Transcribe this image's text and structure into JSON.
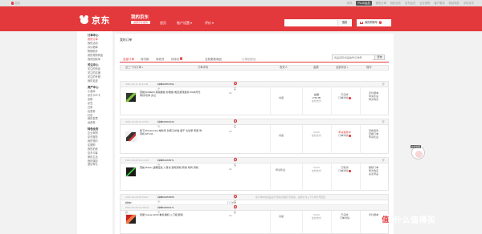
{
  "topbar": {
    "location": "北京",
    "links": [
      "你好，",
      "PLUS会员",
      "我的订单",
      "我的京东",
      "京东会员",
      "企业采购",
      "客户服务",
      "网站导航",
      "手机京东"
    ]
  },
  "header": {
    "logo": "京东",
    "myjd": "我的京东",
    "back": "返回京东首页",
    "nav": [
      "首页",
      "账户设置",
      "评价"
    ],
    "search_placeholder": "",
    "search_button": "搜索",
    "cart_label": "我的购物车",
    "cart_count": "0"
  },
  "sidebar": [
    {
      "title": "订单中心",
      "items": [
        "我的订单",
        "我的活动",
        "评价晒单",
        "购物助手",
        "我的常购商品",
        "我的回收单"
      ]
    },
    {
      "title": "关注中心",
      "items": [
        "关注的商品",
        "关注的店铺",
        "关注的专辑",
        "我的足迹"
      ]
    },
    {
      "title": "资产中心",
      "items": [
        "小金库",
        "京东卡/E卡",
        "余额",
        "京豆",
        "白条",
        "优惠券",
        "红包",
        "我的发票",
        "运费券"
      ]
    },
    {
      "title": "特色业务",
      "items": [
        "企业采购",
        "京东服务",
        "我的预约",
        "定期购",
        "我的拍卖",
        "京东众筹",
        "便民生活",
        "我的保险",
        "邀请有礼"
      ]
    }
  ],
  "main": {
    "title": "我的订单",
    "tabs": [
      {
        "label": "全部订单",
        "count": ""
      },
      {
        "label": "待付款",
        "count": ""
      },
      {
        "label": "待收货",
        "count": ""
      },
      {
        "label": "待评价",
        "count": "1"
      },
      {
        "label": "当前更新商品",
        "count": ""
      },
      {
        "label": "订单回收站",
        "count": ""
      }
    ],
    "order_search_placeholder": "商品名称/商品编号/订单号",
    "order_search_button": "查询",
    "advanced": "高级",
    "columns": [
      "近三个月订单",
      "订单详情",
      "收货人",
      "金额",
      "全部状态",
      "操作"
    ]
  },
  "orders": [
    {
      "date": "2021-01-11 11:31:46",
      "order_no_label": "订单号：",
      "order_no": "224693657694",
      "shop": "京东",
      "product": "雷蛇(RAZER) 炼狱蝰蛇 标准版 电竞游戏鼠标 RGB背光 有线 吃鸡 办公",
      "qty": "×1",
      "receiver": "刘星",
      "amount": "总额",
      "amount_value": "¥ 59.95",
      "pay": "在线支付",
      "status": "已完成",
      "status_link": "订单详情",
      "ops": [
        "评价晒单",
        "申请售后",
        "再次购买"
      ]
    },
    {
      "date": "2021-01-08 13:27:03",
      "order_no_label": "订单号：",
      "order_no": "224843503143",
      "shop": "京东",
      "product": "松下(Panasonic) 电吹风 负离子护发 速干 大功率 家用 吹风机 EH-NA",
      "qty": "×1",
      "receiver": "刘星",
      "amount": "¥0.00",
      "amount_value": "",
      "pay": "在线支付",
      "status": "申请退款中",
      "status_link": "订单详情",
      "ops": [
        "查看退款",
        "查看订单",
        "申请售后"
      ]
    },
    {
      "date": "2021-01-08 19:12:16",
      "order_no_label": "订单号：",
      "order_no": "224861693571",
      "shop": "京东",
      "product": "雷蛇 Razer 战锤狂鲨 入耳式 游戏耳机 有线 吃鸡 耳机",
      "qty": "×1",
      "receiver": "申请售后",
      "amount": "¥0.00",
      "amount_value": "",
      "pay": "在线支付",
      "status": "已取消",
      "status_link": "订单详情",
      "ops": [
        "删除订单",
        "再次购买",
        "关注商品"
      ]
    },
    {
      "date": "2021-01-08 09:59:21",
      "order_no_label": "订单号：",
      "order_no": "224834053556",
      "shop": "京东",
      "summary": "订单金额：¥0.00",
      "product": "",
      "qty": "",
      "receiver": "",
      "amount": "",
      "amount_value": "",
      "pay": "",
      "status": "",
      "status_link": "",
      "ops": []
    },
    {
      "date": "2021-01-08 13:28:40",
      "order_no_label": "订单号：",
      "order_no": "224842590171",
      "shop": "京东",
      "product": "佳能 Canon EOS 单反相机 入门级 套机",
      "qty": "×1",
      "receiver": "刘星",
      "amount": "¥0.00",
      "amount_value": "",
      "pay": "在线支付",
      "status": "已完成",
      "status_link": "订单详情",
      "ops": [
        "评价晒单"
      ]
    }
  ],
  "split_summary": {
    "label": "订单金额：",
    "value": "¥0.00",
    "sub_orders": "子订单号",
    "note": "您订单中的商品在不同库房或属不同商家，故拆分为以下订单分开配送"
  },
  "float": {
    "label": "在线客服"
  },
  "watermark": {
    "zhi": "值",
    "text": "什么值得买"
  }
}
